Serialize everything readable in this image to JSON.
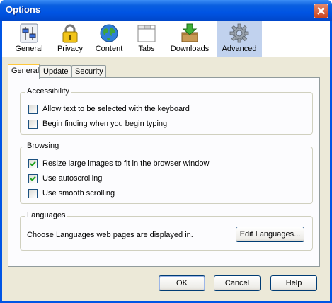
{
  "window": {
    "title": "Options"
  },
  "panes": [
    {
      "label": "General",
      "icon": "general-sliders-icon",
      "selected": false
    },
    {
      "label": "Privacy",
      "icon": "privacy-lock-icon",
      "selected": false
    },
    {
      "label": "Content",
      "icon": "content-globe-icon",
      "selected": false
    },
    {
      "label": "Tabs",
      "icon": "tabs-window-icon",
      "selected": false
    },
    {
      "label": "Downloads",
      "icon": "downloads-box-icon",
      "selected": false
    },
    {
      "label": "Advanced",
      "icon": "advanced-gear-icon",
      "selected": true
    }
  ],
  "tabs": [
    {
      "label": "General",
      "active": true
    },
    {
      "label": "Update",
      "active": false
    },
    {
      "label": "Security",
      "active": false
    }
  ],
  "accessibility": {
    "title": "Accessibility",
    "options": [
      {
        "label": "Allow text to be selected with the keyboard",
        "checked": false
      },
      {
        "label": "Begin finding when you begin typing",
        "checked": false
      }
    ]
  },
  "browsing": {
    "title": "Browsing",
    "options": [
      {
        "label": "Resize large images to fit in the browser window",
        "checked": true
      },
      {
        "label": "Use autoscrolling",
        "checked": true
      },
      {
        "label": "Use smooth scrolling",
        "checked": false
      }
    ]
  },
  "languages": {
    "title": "Languages",
    "description": "Choose Languages web pages are displayed in.",
    "button_label": "Edit Languages..."
  },
  "buttons": {
    "ok": "OK",
    "cancel": "Cancel",
    "help": "Help"
  },
  "colors": {
    "titlebar": "#0054e3",
    "selected_pane": "#c1d2ee",
    "dialog_face": "#ece9d8",
    "checkmark": "#21a121"
  }
}
